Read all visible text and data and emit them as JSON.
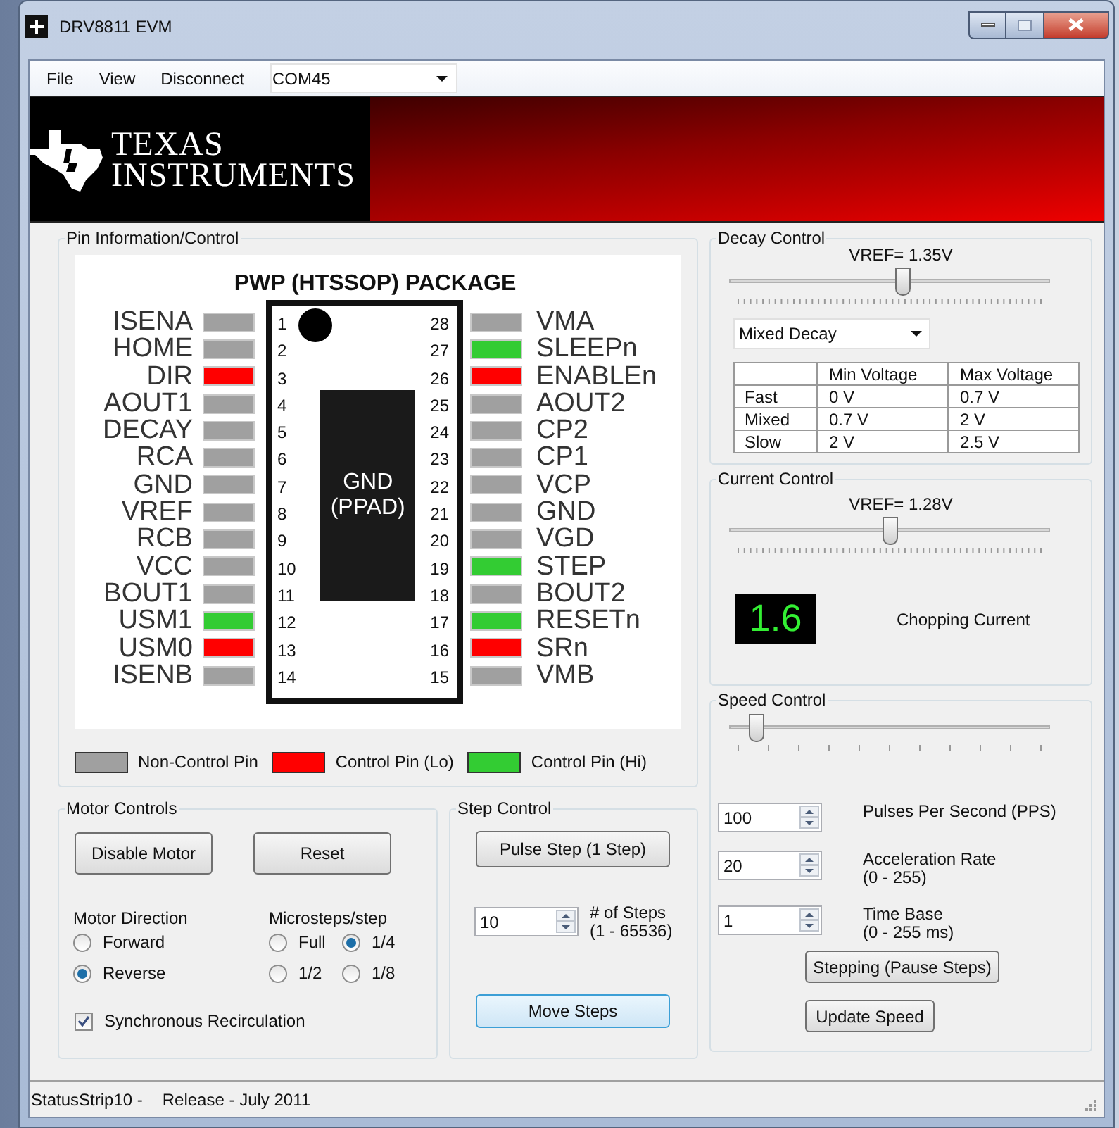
{
  "window": {
    "title": "DRV8811 EVM"
  },
  "menu": [
    {
      "label": "File"
    },
    {
      "label": "View"
    },
    {
      "label": "Disconnect"
    }
  ],
  "port_select": {
    "value": "COM45"
  },
  "banner": {
    "line_1": "TEXAS",
    "line_2": "INSTRUMENTS"
  },
  "pin_panel": {
    "title": "Pin Information/Control",
    "package_title": "PWP (HTSSOP) PACKAGE",
    "pad_label_1": "GND",
    "pad_label_2": "(PPAD)",
    "left_pins": [
      {
        "name": "ISENA",
        "number": "1",
        "color": "#a0a0a0"
      },
      {
        "name": "HOME",
        "number": "2",
        "color": "#a0a0a0"
      },
      {
        "name": "DIR",
        "number": "3",
        "color": "#ff0000"
      },
      {
        "name": "AOUT1",
        "number": "4",
        "color": "#a0a0a0"
      },
      {
        "name": "DECAY",
        "number": "5",
        "color": "#a0a0a0"
      },
      {
        "name": "RCA",
        "number": "6",
        "color": "#a0a0a0"
      },
      {
        "name": "GND",
        "number": "7",
        "color": "#a0a0a0"
      },
      {
        "name": "VREF",
        "number": "8",
        "color": "#a0a0a0"
      },
      {
        "name": "RCB",
        "number": "9",
        "color": "#a0a0a0"
      },
      {
        "name": "VCC",
        "number": "10",
        "color": "#a0a0a0"
      },
      {
        "name": "BOUT1",
        "number": "11",
        "color": "#a0a0a0"
      },
      {
        "name": "USM1",
        "number": "12",
        "color": "#33cc33"
      },
      {
        "name": "USM0",
        "number": "13",
        "color": "#ff0000"
      },
      {
        "name": "ISENB",
        "number": "14",
        "color": "#a0a0a0"
      }
    ],
    "right_pins": [
      {
        "name": "VMA",
        "number": "28",
        "color": "#a0a0a0"
      },
      {
        "name": "SLEEPn",
        "number": "27",
        "color": "#33cc33"
      },
      {
        "name": "ENABLEn",
        "number": "26",
        "color": "#ff0000"
      },
      {
        "name": "AOUT2",
        "number": "25",
        "color": "#a0a0a0"
      },
      {
        "name": "CP2",
        "number": "24",
        "color": "#a0a0a0"
      },
      {
        "name": "CP1",
        "number": "23",
        "color": "#a0a0a0"
      },
      {
        "name": "VCP",
        "number": "22",
        "color": "#a0a0a0"
      },
      {
        "name": "GND",
        "number": "21",
        "color": "#a0a0a0"
      },
      {
        "name": "VGD",
        "number": "20",
        "color": "#a0a0a0"
      },
      {
        "name": "STEP",
        "number": "19",
        "color": "#33cc33"
      },
      {
        "name": "BOUT2",
        "number": "18",
        "color": "#a0a0a0"
      },
      {
        "name": "RESETn",
        "number": "17",
        "color": "#33cc33"
      },
      {
        "name": "SRn",
        "number": "16",
        "color": "#ff0000"
      },
      {
        "name": "VMB",
        "number": "15",
        "color": "#a0a0a0"
      }
    ],
    "legend": [
      {
        "label": "Non-Control Pin",
        "color": "#a0a0a0"
      },
      {
        "label": "Control Pin (Lo)",
        "color": "#ff0000"
      },
      {
        "label": "Control Pin (Hi)",
        "color": "#33cc33"
      }
    ]
  },
  "motor_controls": {
    "title": "Motor Controls",
    "buttons": [
      "Disable Motor",
      "Reset"
    ],
    "direction_label": "Motor Direction",
    "direction": [
      {
        "label": "Forward",
        "selected": false
      },
      {
        "label": "Reverse",
        "selected": true
      }
    ],
    "microsteps_label": "Microsteps/step",
    "microsteps": [
      {
        "label": "Full",
        "selected": false
      },
      {
        "label": "1/4",
        "selected": true
      },
      {
        "label": "1/2",
        "selected": false
      },
      {
        "label": "1/8",
        "selected": false
      }
    ],
    "sync_recirculation": {
      "label": "Synchronous Recirculation",
      "checked": true
    }
  },
  "step_control": {
    "title": "Step Control",
    "pulse_button": "Pulse Step (1 Step)",
    "steps_value": "10",
    "steps_label": "# of Steps",
    "steps_range": "(1 - 65536)",
    "move_button": "Move Steps"
  },
  "decay_control": {
    "title": "Decay Control",
    "reading": "VREF= 1.35V",
    "level": 0.54,
    "mode": "Mixed Decay",
    "table": {
      "columns": [
        "Min Voltage",
        "Max Voltage"
      ],
      "rows": [
        {
          "label": "Fast",
          "cells": [
            "0 V",
            "0.7 V"
          ]
        },
        {
          "label": "Mixed",
          "cells": [
            "0.7 V",
            "2 V"
          ]
        },
        {
          "label": "Slow",
          "cells": [
            "2 V",
            "2.5 V"
          ]
        }
      ]
    }
  },
  "current_control": {
    "title": "Current Control",
    "reading": "VREF= 1.28V",
    "level": 0.5,
    "display": "1.6",
    "display_label": "Chopping Current"
  },
  "speed_control": {
    "title": "Speed Control",
    "level": 0.08,
    "fields": [
      {
        "value": "100",
        "label": "Pulses Per Second (PPS)"
      },
      {
        "value": "20",
        "label": "Acceleration Rate",
        "note": "(0 - 255)"
      },
      {
        "value": "1",
        "label": "Time Base",
        "note": "(0 - 255 ms)"
      }
    ],
    "buttons": [
      "Stepping (Pause Steps)",
      "Update Speed"
    ]
  },
  "status_bar": [
    "StatusStrip10 -",
    "Release - July 2011"
  ]
}
